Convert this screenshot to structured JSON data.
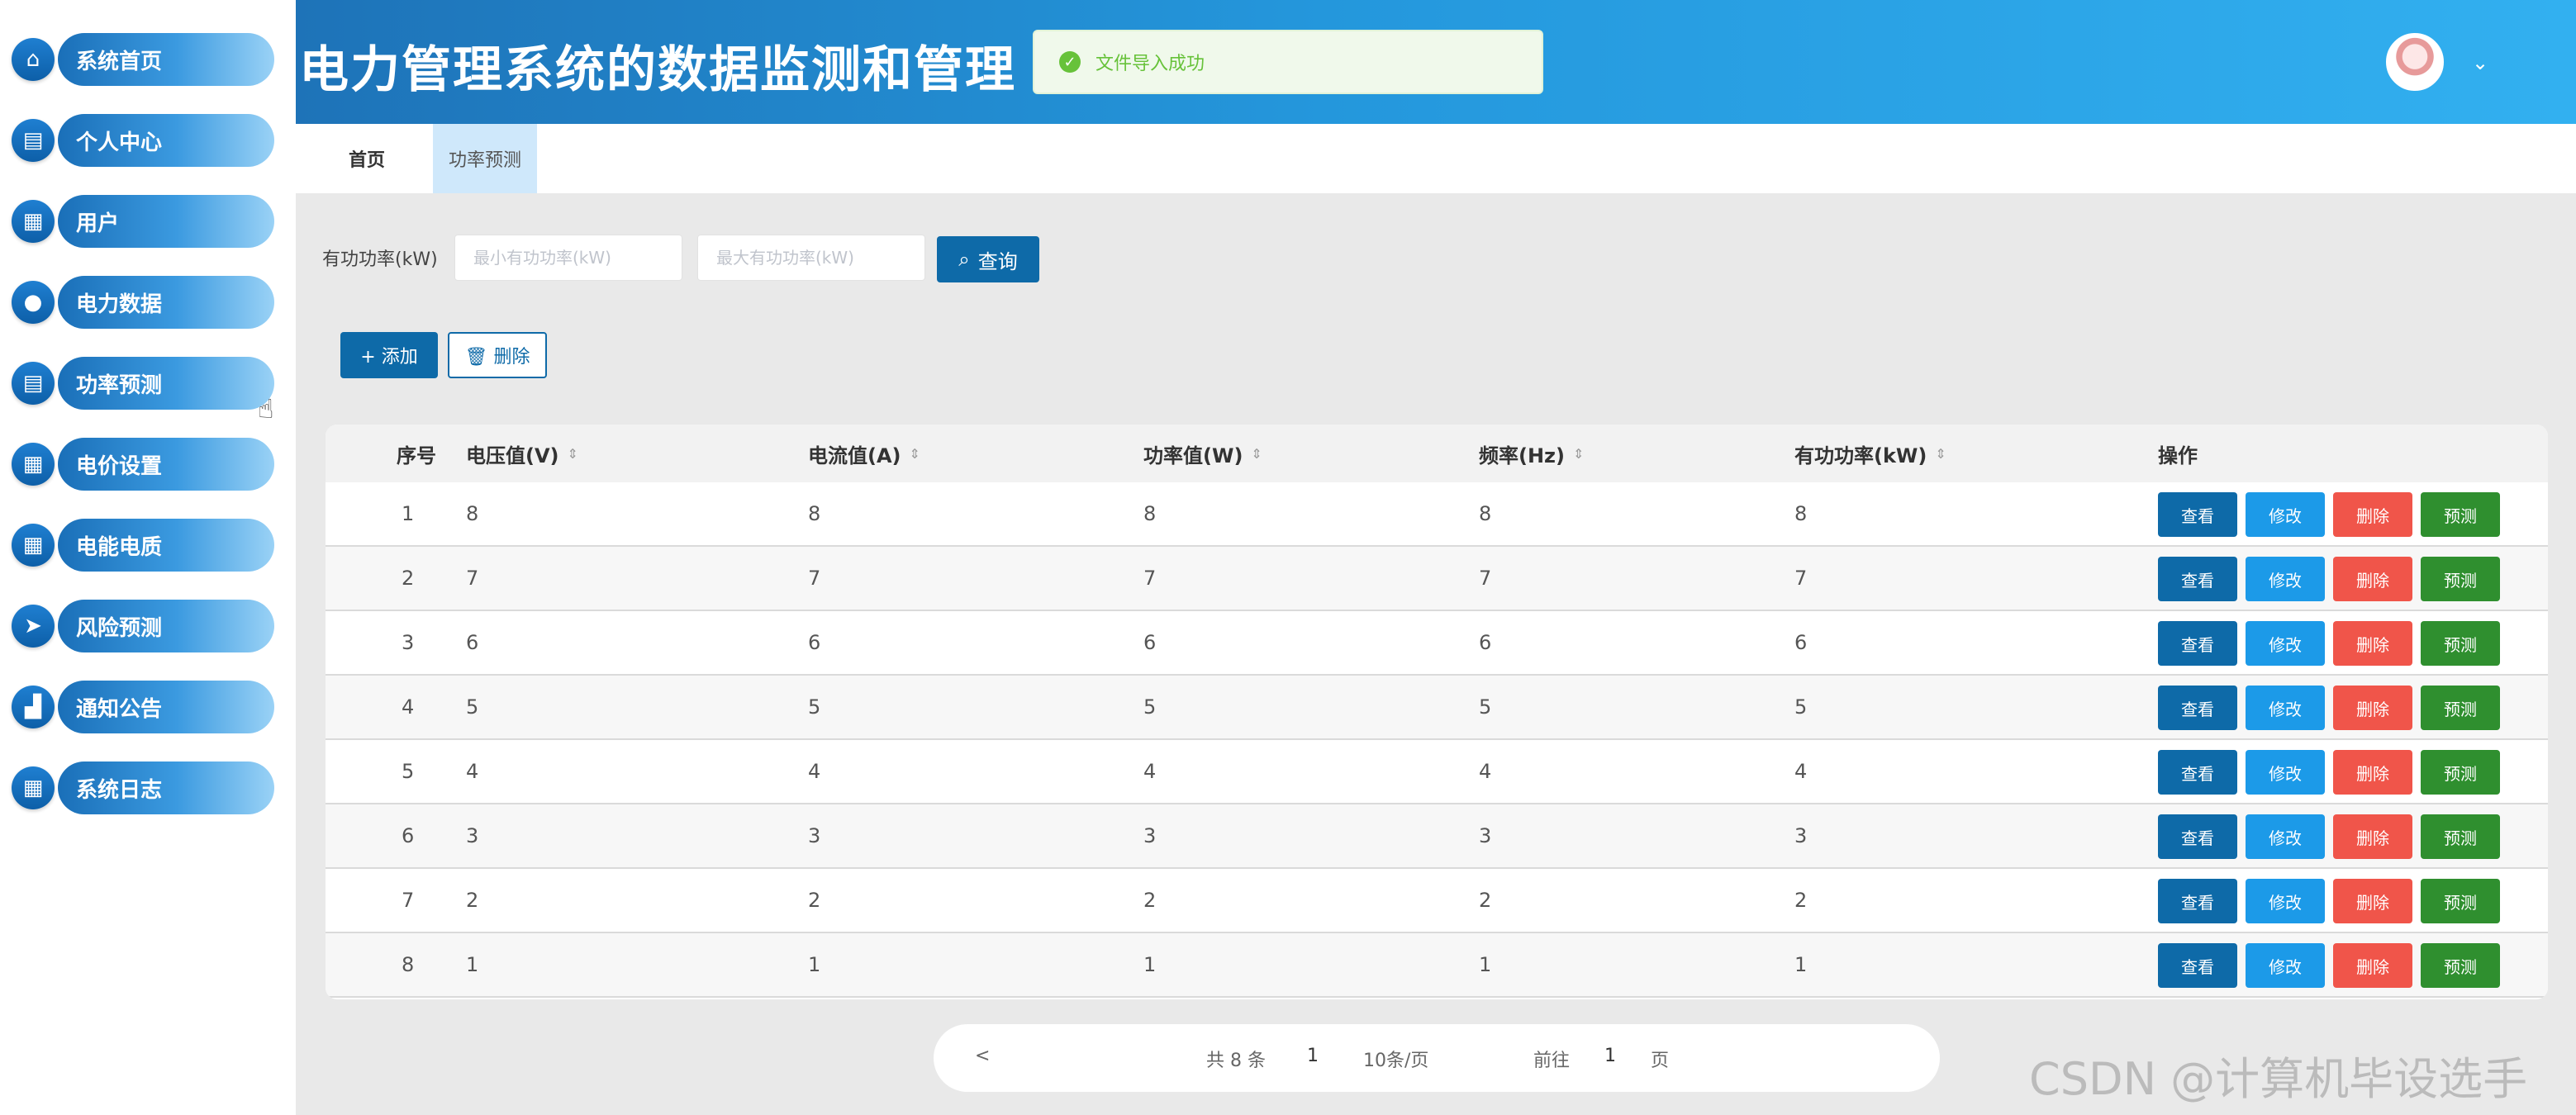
{
  "sidebar": {
    "items": [
      {
        "label": "系统首页",
        "icon": "home-icon",
        "glyph": "⌂"
      },
      {
        "label": "个人中心",
        "icon": "profile-icon",
        "glyph": "▤"
      },
      {
        "label": "用户",
        "icon": "grid-icon",
        "glyph": "▦"
      },
      {
        "label": "电力数据",
        "icon": "user-icon",
        "glyph": "●"
      },
      {
        "label": "功率预测",
        "icon": "doc-icon",
        "glyph": "▤"
      },
      {
        "label": "电价设置",
        "icon": "grid-icon",
        "glyph": "▦"
      },
      {
        "label": "电能电质",
        "icon": "grid-icon",
        "glyph": "▦"
      },
      {
        "label": "风险预测",
        "icon": "send-icon",
        "glyph": "➤"
      },
      {
        "label": "通知公告",
        "icon": "chart-icon",
        "glyph": "▟"
      },
      {
        "label": "系统日志",
        "icon": "grid-icon",
        "glyph": "▦"
      }
    ]
  },
  "header": {
    "title": "电力管理系统的数据监测和管理",
    "toast": "文件导入成功",
    "caret": "⌄"
  },
  "tabs": [
    {
      "label": "首页"
    },
    {
      "label": "功率预测"
    }
  ],
  "search": {
    "label": "有功功率(kW)",
    "min_placeholder": "最小有功功率(kW)",
    "max_placeholder": "最大有功功率(kW)",
    "query_label": "查询",
    "query_icon": "⌕"
  },
  "actions": {
    "add_label": "+ 添加",
    "delete_label": "🗑 删除"
  },
  "table": {
    "headers": [
      "序号",
      "电压值(V)",
      "电流值(A)",
      "功率值(W)",
      "频率(Hz)",
      "有功功率(kW)",
      "操作"
    ],
    "sort_glyph": "⇕",
    "rows": [
      [
        "1",
        "8",
        "8",
        "8",
        "8",
        "8"
      ],
      [
        "2",
        "7",
        "7",
        "7",
        "7",
        "7"
      ],
      [
        "3",
        "6",
        "6",
        "6",
        "6",
        "6"
      ],
      [
        "4",
        "5",
        "5",
        "5",
        "5",
        "5"
      ],
      [
        "5",
        "4",
        "4",
        "4",
        "4",
        "4"
      ],
      [
        "6",
        "3",
        "3",
        "3",
        "3",
        "3"
      ],
      [
        "7",
        "2",
        "2",
        "2",
        "2",
        "2"
      ],
      [
        "8",
        "1",
        "1",
        "1",
        "1",
        "1"
      ]
    ],
    "ops": {
      "view": "查看",
      "edit": "修改",
      "remove": "删除",
      "predict": "预测"
    }
  },
  "pager": {
    "prev": "<",
    "total": "共 8 条",
    "page": "1",
    "page_size": "10条/页",
    "goto_label": "前往",
    "goto_page": "1",
    "page_unit": "页"
  },
  "watermark": "CSDN @计算机毕设选手",
  "colors": {
    "primary": "#0e6aa8",
    "edit": "#1c9ae8",
    "danger": "#f0554a",
    "success": "#2f8f2f"
  }
}
